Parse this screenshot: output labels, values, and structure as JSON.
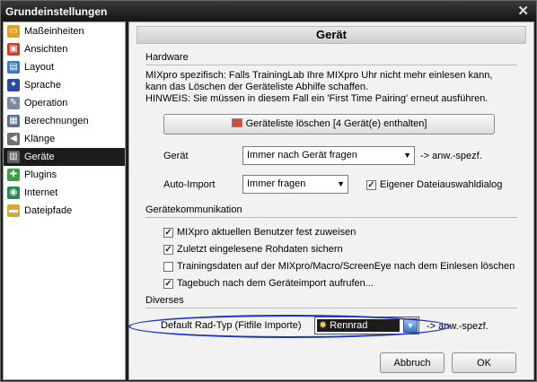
{
  "window": {
    "title": "Grundeinstellungen",
    "close_glyph": "✕"
  },
  "sidebar": {
    "items": [
      {
        "label": "Maßeinheiten",
        "icon": "ruler-icon",
        "color": "#e0a020",
        "glyph": "▭"
      },
      {
        "label": "Ansichten",
        "icon": "window-icon",
        "color": "#d04020",
        "glyph": "▣"
      },
      {
        "label": "Layout",
        "icon": "layout-icon",
        "color": "#3a78c0",
        "glyph": "▤"
      },
      {
        "label": "Sprache",
        "icon": "flag-icon",
        "color": "#2a4aa0",
        "glyph": "✦"
      },
      {
        "label": "Operation",
        "icon": "wrench-icon",
        "color": "#7a8aa0",
        "glyph": "✎"
      },
      {
        "label": "Berechnungen",
        "icon": "calculator-icon",
        "color": "#5a7090",
        "glyph": "▦"
      },
      {
        "label": "Klänge",
        "icon": "speaker-icon",
        "color": "#707070",
        "glyph": "◀"
      },
      {
        "label": "Geräte",
        "icon": "device-icon",
        "color": "#606060",
        "glyph": "▥",
        "selected": true
      },
      {
        "label": "Plugins",
        "icon": "puzzle-icon",
        "color": "#3aa040",
        "glyph": "✚"
      },
      {
        "label": "Internet",
        "icon": "globe-icon",
        "color": "#2a8a50",
        "glyph": "◉"
      },
      {
        "label": "Dateipfade",
        "icon": "folder-icon",
        "color": "#d8a830",
        "glyph": "▬"
      }
    ]
  },
  "main": {
    "header": "Gerät",
    "hardware": {
      "section": "Hardware",
      "info_line1": "MIXpro spezifisch: Falls TrainingLab Ihre MIXpro Uhr nicht mehr einlesen kann,",
      "info_line2": "kann das Löschen der Geräteliste Abhilfe schaffen.",
      "info_line3": "HINWEIS: Sie müssen in diesem Fall ein 'First Time Pairing' erneut ausführen.",
      "clear_button": "Geräteliste löschen  [4 Gerät(e) enthalten]",
      "device_label": "Gerät",
      "device_value": "Immer nach Gerät fragen",
      "device_note": "-> anw.-spezf.",
      "autoimport_label": "Auto-Import",
      "autoimport_value": "Immer fragen",
      "own_dialog_label": "Eigener Dateiauswahldialog",
      "own_dialog_checked": true
    },
    "kommunikation": {
      "section": "Gerätekommunikation",
      "options": [
        {
          "label": "MIXpro aktuellen Benutzer fest zuweisen",
          "checked": true
        },
        {
          "label": "Zuletzt eingelesene Rohdaten sichern",
          "checked": true
        },
        {
          "label": "Trainingsdaten auf der MIXpro/Macro/ScreenEye nach dem Einlesen löschen",
          "checked": false
        },
        {
          "label": "Tagebuch nach dem Geräteimport aufrufen...",
          "checked": true
        }
      ]
    },
    "diverses": {
      "section": "Diverses",
      "radtyp_label": "Default Rad-Typ (Fitfile Importe)",
      "radtyp_value": "Rennrad",
      "radtyp_note": "-> anw.-spezf."
    },
    "cancel_button": "Abbruch",
    "ok_button": "OK"
  },
  "colors": {
    "selection": "#1c1c1c",
    "highlight_ellipse": "#1a2fd4"
  }
}
